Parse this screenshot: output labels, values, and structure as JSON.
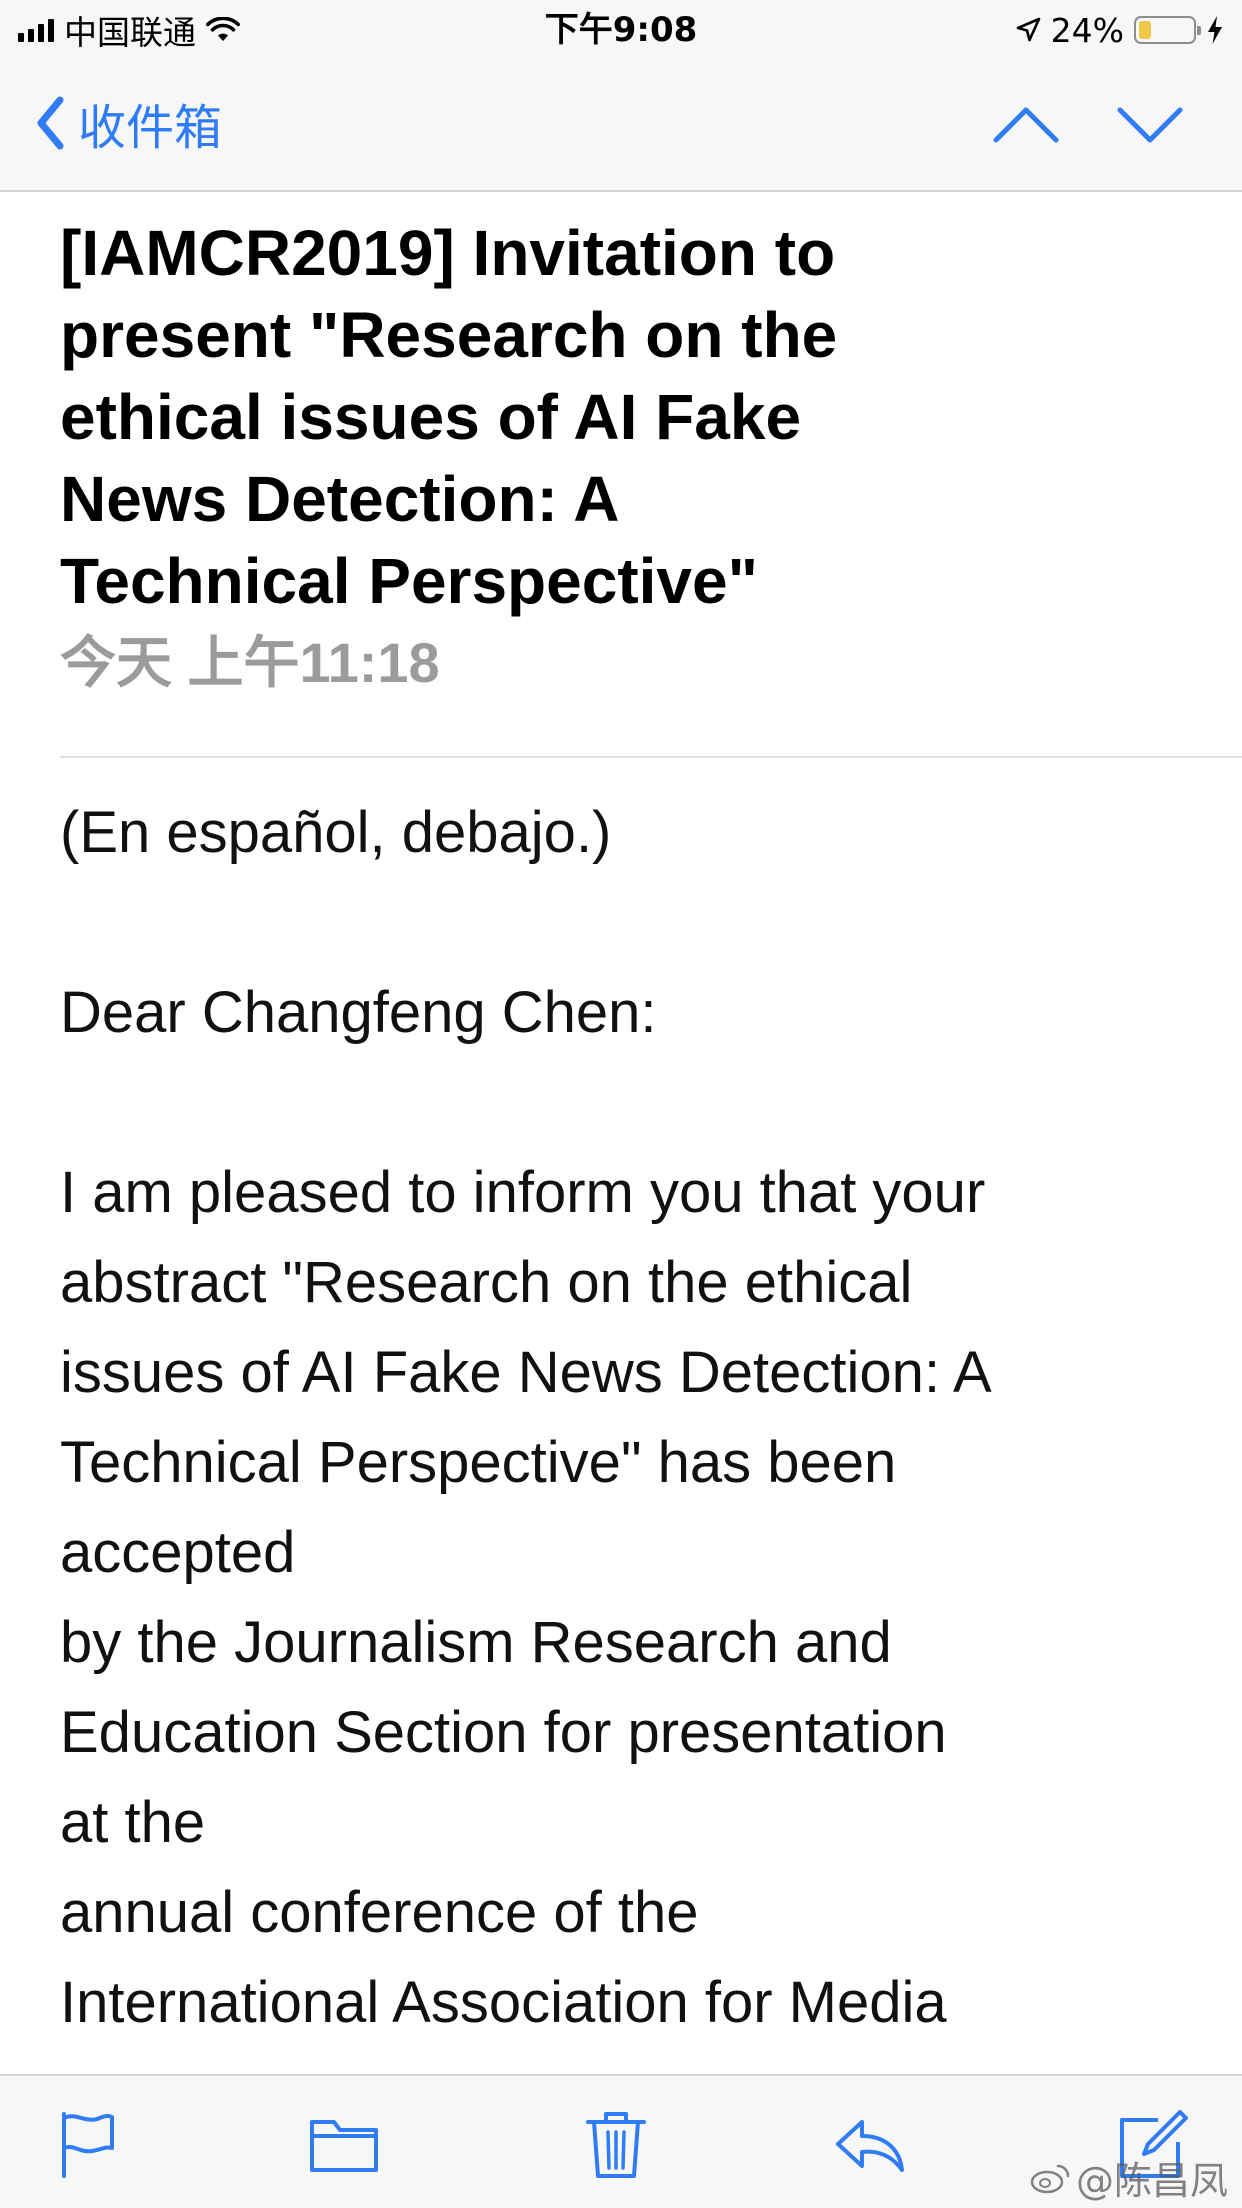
{
  "status_bar": {
    "carrier": "中国联通",
    "time": "下午9:08",
    "battery_percent": "24%",
    "battery_level": 0.24,
    "battery_color": "#f2c84b",
    "icons": [
      "signal-icon",
      "wifi-icon",
      "location-icon",
      "battery-icon",
      "charging-icon"
    ]
  },
  "nav": {
    "back_label": "收件箱",
    "accent_color": "#2f7cf6",
    "icons": [
      "chevron-left-icon",
      "chevron-up-icon",
      "chevron-down-icon"
    ]
  },
  "message": {
    "subject": "[IAMCR2019] Invitation to\npresent \"Research on the\nethical issues of AI  Fake\nNews Detection: A\nTechnical Perspective\"",
    "date": "今天 上午11:18",
    "body": "(En español, debajo.)\n\nDear Changfeng Chen:\n\nI am pleased to inform you that your\nabstract \"Research on the ethical\nissues of AI Fake News Detection: A\nTechnical Perspective\" has been\naccepted\nby the Journalism Research and\nEducation Section for presentation\nat the\nannual conference of the\nInternational Association for Media"
  },
  "toolbar": {
    "icons": [
      "flag-icon",
      "folder-icon",
      "trash-icon",
      "reply-icon",
      "compose-icon"
    ]
  },
  "watermark": {
    "text": "@陈昌凤"
  }
}
